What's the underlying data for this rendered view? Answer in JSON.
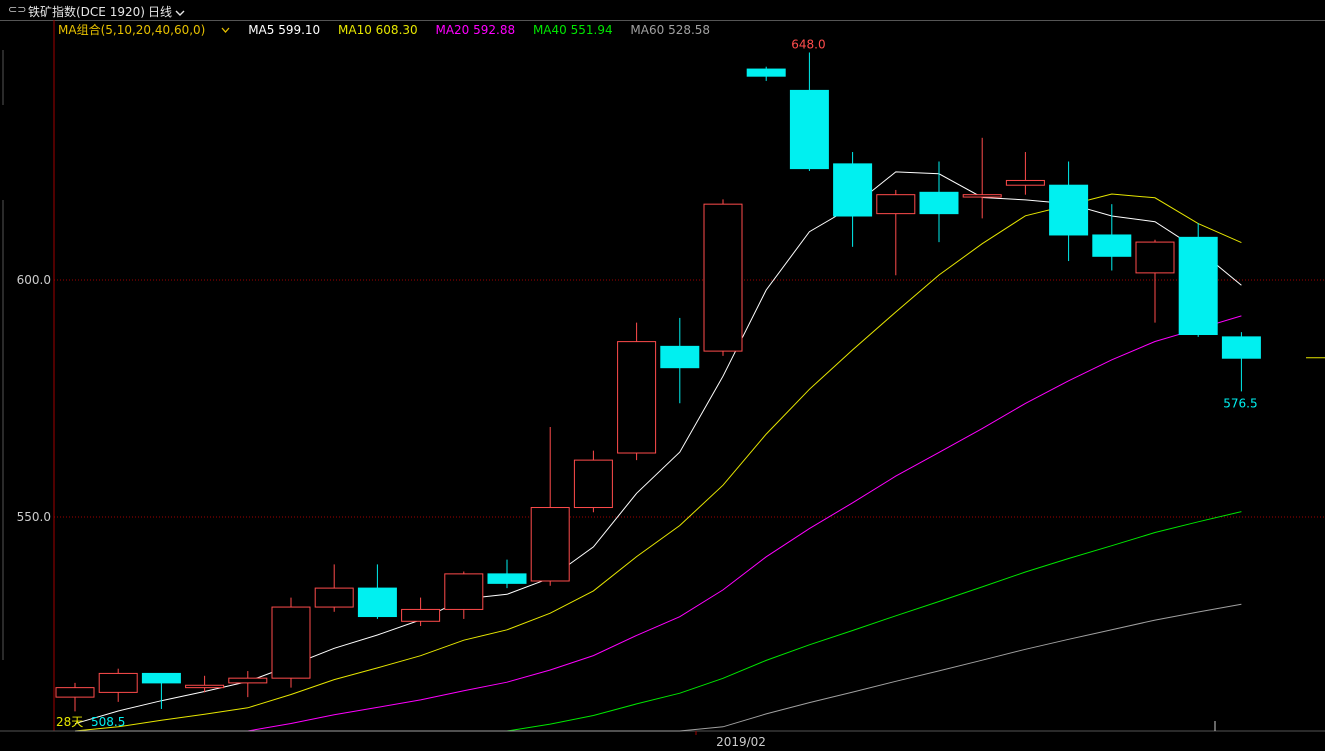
{
  "header": {
    "link_icon": "⊂⊃",
    "title": "铁矿指数(DCE 1920)",
    "period": "日线",
    "period_icon": "chevron-down"
  },
  "legend": {
    "combo": "MA组合(5,10,20,40,60,0)",
    "ma5": "MA5 599.10",
    "ma10": "MA10 608.30",
    "ma20": "MA20 592.88",
    "ma40": "MA40 551.94",
    "ma60": "MA60 528.58"
  },
  "colors": {
    "up": "#ff4c4c",
    "down": "#00f0f0",
    "ma5": "#ffffff",
    "ma10": "#e6e600",
    "ma20": "#ff00ff",
    "ma40": "#00e600",
    "ma60": "#a0a0a0",
    "grid": "#a00000",
    "axis": "#a00000"
  },
  "chart_data": {
    "type": "candlestick",
    "ylim": [
      505,
      648
    ],
    "yticks": [
      "600.0",
      "550.0"
    ],
    "ytick_values": [
      600,
      550
    ],
    "xticks": [
      "2019/02"
    ],
    "high_label": "648.0",
    "high_value": 648,
    "low_label": "576.5",
    "low_value": 576.5,
    "bottom_left_days": "28天",
    "bottom_left_value": "508.5",
    "candles": [
      {
        "o": 512,
        "c": 514,
        "h": 515,
        "l": 509
      },
      {
        "o": 513,
        "c": 517,
        "h": 518,
        "l": 511
      },
      {
        "o": 517,
        "c": 515,
        "h": 517,
        "l": 509.5
      },
      {
        "o": 514,
        "c": 514.5,
        "h": 516.5,
        "l": 513
      },
      {
        "o": 515,
        "c": 516,
        "h": 517.5,
        "l": 512
      },
      {
        "o": 516,
        "c": 531,
        "h": 533,
        "l": 514
      },
      {
        "o": 531,
        "c": 535,
        "h": 540,
        "l": 530
      },
      {
        "o": 535,
        "c": 529,
        "h": 540,
        "l": 528.5
      },
      {
        "o": 528,
        "c": 530.5,
        "h": 533,
        "l": 527
      },
      {
        "o": 530.5,
        "c": 538,
        "h": 538.5,
        "l": 528.5
      },
      {
        "o": 538,
        "c": 536,
        "h": 541,
        "l": 535
      },
      {
        "o": 536.5,
        "c": 552,
        "h": 569,
        "l": 535.5
      },
      {
        "o": 552,
        "c": 562,
        "h": 564,
        "l": 551
      },
      {
        "o": 563.5,
        "c": 587,
        "h": 591,
        "l": 562
      },
      {
        "o": 586,
        "c": 581.5,
        "h": 592,
        "l": 574
      },
      {
        "o": 585,
        "c": 616,
        "h": 617,
        "l": 584
      },
      {
        "o": 644.5,
        "c": 643,
        "h": 645,
        "l": 642
      },
      {
        "o": 640,
        "c": 623.5,
        "h": 648,
        "l": 623
      },
      {
        "o": 624.5,
        "c": 613.5,
        "h": 627,
        "l": 607
      },
      {
        "o": 614,
        "c": 618,
        "h": 619,
        "l": 601
      },
      {
        "o": 618.5,
        "c": 614,
        "h": 625,
        "l": 608
      },
      {
        "o": 617.5,
        "c": 618,
        "h": 630,
        "l": 613
      },
      {
        "o": 620,
        "c": 621,
        "h": 627,
        "l": 618
      },
      {
        "o": 620,
        "c": 609.5,
        "h": 625,
        "l": 604
      },
      {
        "o": 609.5,
        "c": 605,
        "h": 616,
        "l": 602
      },
      {
        "o": 601.5,
        "c": 608,
        "h": 608.5,
        "l": 591
      },
      {
        "o": 609,
        "c": 588.5,
        "h": 612,
        "l": 588
      },
      {
        "o": 588,
        "c": 583.5,
        "h": 589,
        "l": 576.5
      }
    ],
    "series": [
      {
        "name": "MA5",
        "values": [
          null,
          null,
          null,
          null,
          514.2,
          514.6,
          515.4,
          517.9,
          520.7,
          523.5,
          526.2,
          528.7,
          532.4,
          535.2,
          541,
          551.5,
          563.9,
          577.6,
          590.3,
          601,
          611.5,
          623,
          625.5,
          625.5,
          621,
          617,
          615.5,
          612.5,
          609,
          599.1
        ]
      },
      {
        "name": "MA10",
        "values": [
          null,
          null,
          null,
          null,
          null,
          null,
          null,
          null,
          null,
          510,
          512,
          514.5,
          516.5,
          518,
          520.5,
          523,
          526,
          530.5,
          534.5,
          542,
          549,
          557,
          567,
          577.5,
          586,
          594,
          601,
          607,
          613,
          617,
          616,
          618,
          618,
          615,
          608.3
        ]
      },
      {
        "name": "MA20",
        "values": [
          null,
          null,
          null,
          null,
          null,
          null,
          null,
          null,
          null,
          null,
          null,
          null,
          null,
          null,
          null,
          null,
          null,
          null,
          null,
          null,
          null,
          null,
          null,
          null,
          null,
          null,
          null,
          null,
          null,
          null
        ]
      },
      {
        "name": "MA40",
        "values": []
      },
      {
        "name": "MA60",
        "values": []
      }
    ]
  }
}
